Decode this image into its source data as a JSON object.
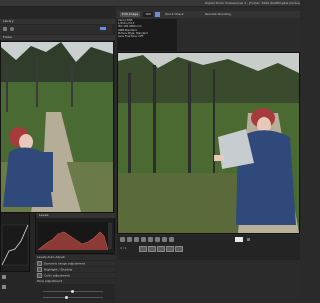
{
  "window": {
    "title": "Digital Photo Professional 4 - [Folder: 3060 Wolff/Digital photos/2013]"
  },
  "left_panel": {
    "top_header": "Library",
    "thumb_header": "Folder"
  },
  "viewer": {
    "toolbar": {
      "edit_label": "Edit image",
      "zoom_value": "100",
      "quick_check_label": "Quick Check",
      "remote_shooting_label": "Remote Shooting"
    },
    "exif": {
      "lines": [
        "Canon EOS",
        "1/250 s f/4.5",
        "ISO 100 4000 mm",
        "AWB  Standard",
        "Picture Style: Standard",
        "Lens Fine-Tune: OFF"
      ]
    }
  },
  "levels_panel": {
    "header": "Levels",
    "rows": [
      "Levels Auto Adjust",
      "Dynamic range adjustment",
      "Highlight / Shadow",
      "Color adjustment",
      "Tone adjustment"
    ]
  },
  "bottom_bar": {
    "page_label": "1 / 1"
  },
  "colors": {
    "accent": "#6a8fd6",
    "panel_bg": "#2a2a2a",
    "scarf_red": "#a73b3b",
    "jacket_blue": "#2f4a7a"
  },
  "icons": [
    "search-icon",
    "grid-icon",
    "histogram-icon",
    "chevron-down-icon",
    "play-icon",
    "fit-icon"
  ]
}
